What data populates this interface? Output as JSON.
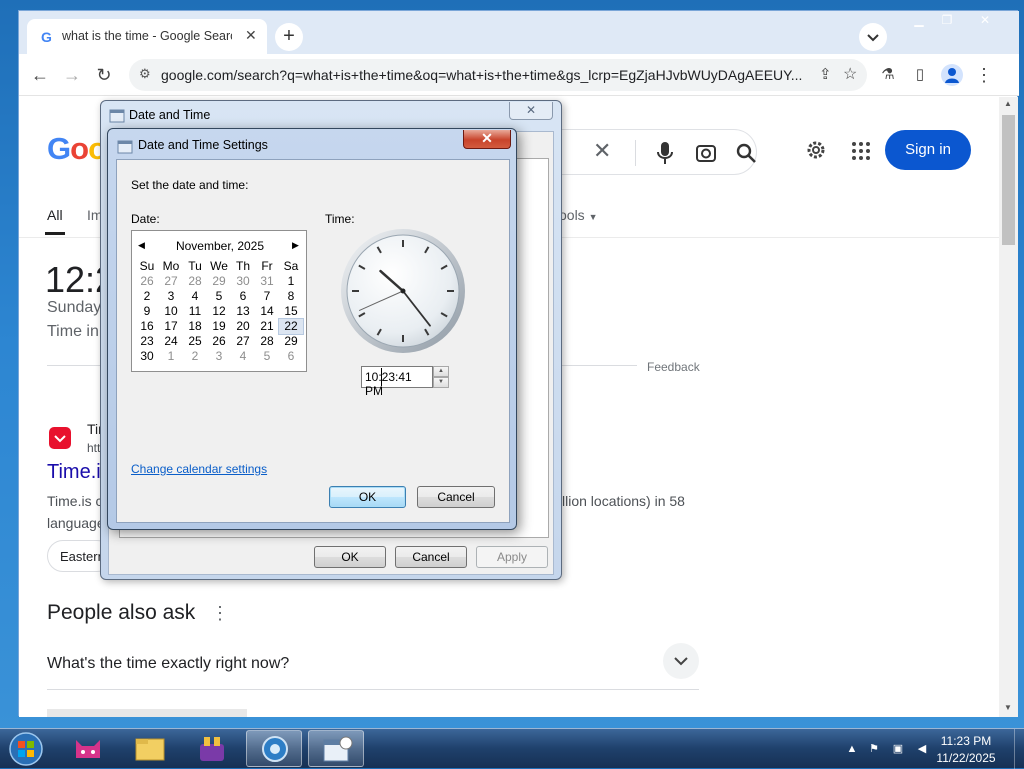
{
  "browser": {
    "tab_title": "what is the time - Google Search",
    "new_tab": "+",
    "url": "google.com/search?q=what+is+the+time&oq=what+is+the+time&gs_lcrp=EgZjaHJvbWUyDAgAEEUY..."
  },
  "google": {
    "logo_letters": [
      "G",
      "o",
      "o"
    ],
    "sign_in": "Sign in",
    "tab_all": "All",
    "tab_images_partial": "Im",
    "tools": "ools",
    "time_partial": "12:2",
    "date_partial": "Sunday,",
    "timezone_partial": "Time in",
    "feedback": "Feedback",
    "result_site_partial": "Tir",
    "result_url_partial": "htt",
    "result_title_partial": "Time.i",
    "snippet_line1_partial": "Time.is c",
    "snippet_line2_partial": "language",
    "snippet_right": "llion locations) in 58",
    "chip_partial": "Eastern",
    "people_also_ask": "People also ask",
    "question1": "What's the time exactly right now?"
  },
  "date_time_dialog": {
    "title": "Date and Time",
    "ok": "OK",
    "cancel": "Cancel",
    "apply": "Apply"
  },
  "settings_dialog": {
    "title": "Date and Time Settings",
    "prompt": "Set the date and time:",
    "date_label": "Date:",
    "time_label": "Time:",
    "calendar": {
      "month_label": "November, 2025",
      "weekdays": [
        "Su",
        "Mo",
        "Tu",
        "We",
        "Th",
        "Fr",
        "Sa"
      ],
      "weeks": [
        [
          "26",
          "27",
          "28",
          "29",
          "30",
          "31",
          "1"
        ],
        [
          "2",
          "3",
          "4",
          "5",
          "6",
          "7",
          "8"
        ],
        [
          "9",
          "10",
          "11",
          "12",
          "13",
          "14",
          "15"
        ],
        [
          "16",
          "17",
          "18",
          "19",
          "20",
          "21",
          "22"
        ],
        [
          "23",
          "24",
          "25",
          "26",
          "27",
          "28",
          "29"
        ],
        [
          "30",
          "1",
          "2",
          "3",
          "4",
          "5",
          "6"
        ]
      ],
      "selected_day": "22"
    },
    "clock": {
      "hours": 10,
      "minutes": 23,
      "seconds": 41
    },
    "time_value": "10:23:41 PM",
    "change_calendar_link": "Change calendar settings",
    "ok": "OK",
    "cancel": "Cancel"
  },
  "taskbar": {
    "time": "11:23 PM",
    "date": "11/22/2025"
  },
  "colors": {
    "accent_blue": "#0b57d0",
    "link_blue": "#0a5ec9",
    "close_red": "#c8442b"
  }
}
